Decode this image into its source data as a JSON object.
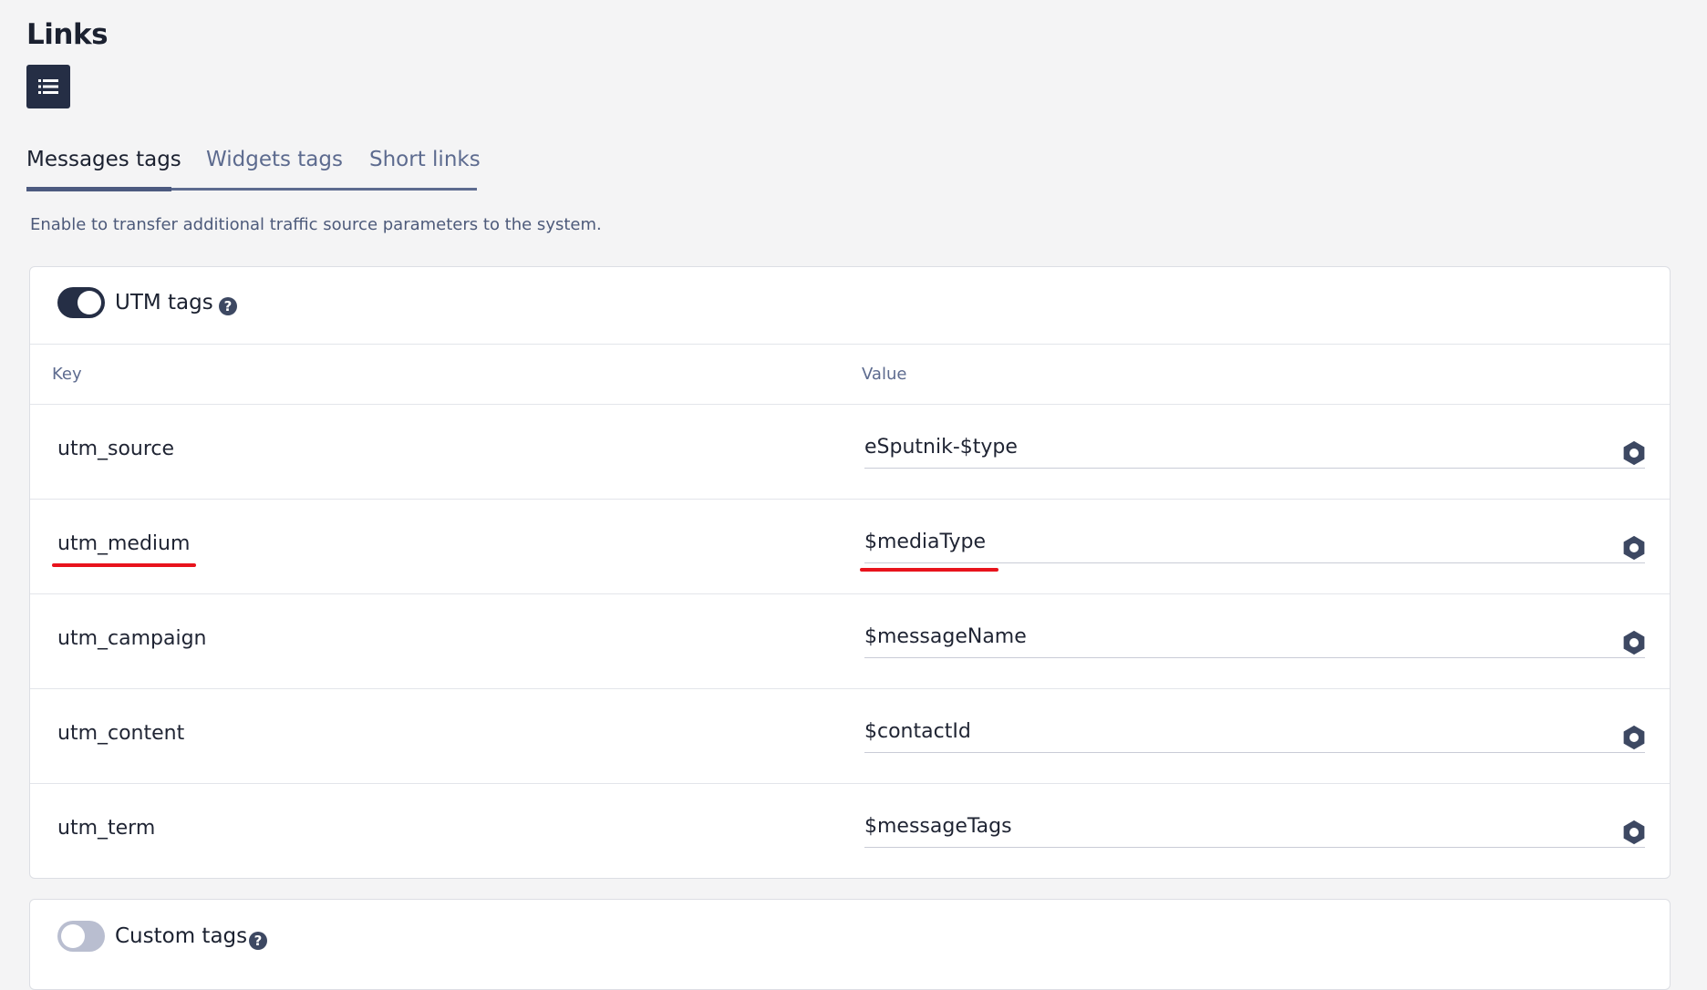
{
  "page": {
    "title": "Links",
    "list_button_icon": "list-icon"
  },
  "tabs": [
    {
      "label": "Messages tags",
      "active": true
    },
    {
      "label": "Widgets tags",
      "active": false
    },
    {
      "label": "Short links",
      "active": false
    }
  ],
  "description": "Enable to transfer additional traffic source parameters to the system.",
  "utm": {
    "enabled": true,
    "title": "UTM tags",
    "help_icon": "question-icon",
    "help_glyph": "?",
    "columns": {
      "key": "Key",
      "value": "Value"
    },
    "rows": [
      {
        "key": "utm_source",
        "value": "eSputnik-$type",
        "settings_icon": "gear-icon",
        "highlighted": false
      },
      {
        "key": "utm_medium",
        "value": "$mediaType",
        "settings_icon": "gear-icon",
        "highlighted": true
      },
      {
        "key": "utm_campaign",
        "value": "$messageName",
        "settings_icon": "gear-icon",
        "highlighted": false
      },
      {
        "key": "utm_content",
        "value": "$contactId",
        "settings_icon": "gear-icon",
        "highlighted": false
      },
      {
        "key": "utm_term",
        "value": "$messageTags",
        "settings_icon": "gear-icon",
        "highlighted": false
      }
    ]
  },
  "custom": {
    "enabled": false,
    "title": "Custom tags",
    "help_icon": "question-icon",
    "help_glyph": "?"
  },
  "colors": {
    "primary_dark": "#252e45",
    "muted_text": "#5d6b8f",
    "highlight_red": "#e8131c",
    "toggle_off": "#b9bed0"
  }
}
